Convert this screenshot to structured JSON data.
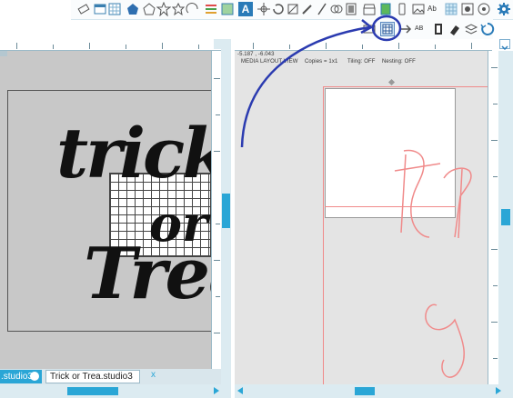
{
  "tabs": {
    "first_label": ".studio3",
    "second_label": "Trick or Trea.studio3",
    "second_close": "x"
  },
  "status_bar": {
    "coords": "-5.187 , -6.043",
    "layout_view": "MEDIA LAYOUT VIEW",
    "copies": "Copies = 1x1",
    "tiling": "Tiling: OFF",
    "nesting": "Nesting: OFF"
  },
  "canvas_text": {
    "line1": "trick",
    "line2": "or",
    "line3": "Trea"
  },
  "toolbar": {
    "text_tool_label": "A",
    "text_style_label": "Ab",
    "replicate_label": "AB"
  },
  "colors": {
    "accent": "#2aa6d6",
    "highlight_ring": "#2b3bb0",
    "cut_line": "#f08a8a",
    "canvas_grey": "#c8c8c8"
  },
  "icons": [
    "settings-gear-icon",
    "refresh-icon",
    "collapse-toolbar-icon",
    "media-layout-icon",
    "shapes-icon",
    "text-icon"
  ]
}
